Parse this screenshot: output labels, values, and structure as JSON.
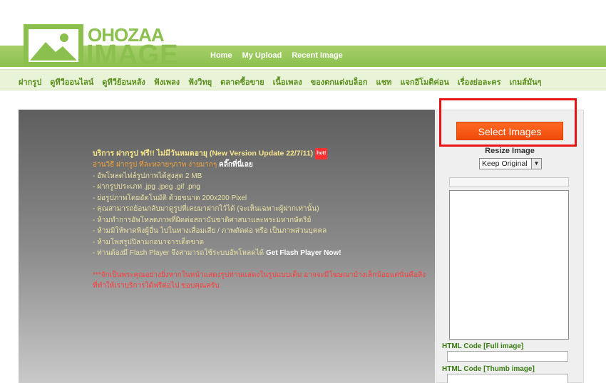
{
  "logo": {
    "line1": "OHOZAA",
    "line2": "IMAGE"
  },
  "top_nav": [
    "Home",
    "My Upload",
    "Recent Image"
  ],
  "categories": [
    "ฝากรูป",
    "ดูทีวีออนไลน์",
    "ดูทีวีย้อนหลัง",
    "ฟังเพลง",
    "ฟังวิทยุ",
    "ตลาดซื้อขาย",
    "เนื้อเพลง",
    "ของตกแต่งบล็อก",
    "แชท",
    "แจกอีโมติค่อน",
    "เรื่องย่อละคร",
    "เกมส์มันๆ"
  ],
  "info": {
    "title": "บริการ ฝากรูป ฟรี!! ไม่มีวันหมดอายุ (New Version Update 22/7/11)",
    "hot_badge": "hot!",
    "howto": "อ่านวิธี ฝากรูป ทีละหลายๆภาพ ง่ายมากๆ",
    "howto_link": "คลิ๊กที่นี่เลย",
    "bullets": [
      "- อัพโหลดไฟล์รูปภาพได้สูงสุด 2 MB",
      "- ฝากรูปประเภท .jpg .jpeg .gif .png",
      "- ย่อรูปภาพโดยอัตโนมัติ ด้วยขนาด 200x200 Pixel",
      "- คุณสามารถย้อนกลับมาดูรูปที่เคยมาฝากไว้ได้ (จะเห็นเฉพาะผู้ฝากเท่านั้น)",
      "- ห้ามทำการอัพโหลดภาพที่ผิดต่อสถาบันชาติศาสนาและพระมหากษัตริย์",
      "- ห้ามมิให้พาดพิงผู้อื่น ไปในทางเสื่อมเสีย / ภาพตัดต่อ หรือ เป็นภาพส่วนบุคคล",
      "- ห้ามโพสรูปปิลามกอนาจารเด็ดขาด"
    ],
    "flash_text": "- ท่านต้องมี Flash Player จึงสามารถใช้ระบบอัพโหลดได้",
    "flash_link": "Get Flash Player Now!",
    "warning": "***จักเป็นพระคุณอย่างยิ่งหากในหน้าแสดงรูปท่านแสดงในรูปแบบเต็ม อาจจะมีโฆษณาบ้างเล็กน้อยแต่นั่นคือสิ่งที่ทำให้เราบริการได้ฟรีต่อไป ขอบคุณครับ"
  },
  "sidebar": {
    "select_button": "Select Images",
    "resize_label": "Resize Image",
    "resize_value": "Keep Original",
    "full_code_label": "HTML Code [Full image]",
    "thumb_code_label": "HTML Code [Thumb image]"
  },
  "colors": {
    "brand_green": "#8cc04e",
    "highlight_red": "#e81313",
    "button_orange": "#f04a0a"
  }
}
